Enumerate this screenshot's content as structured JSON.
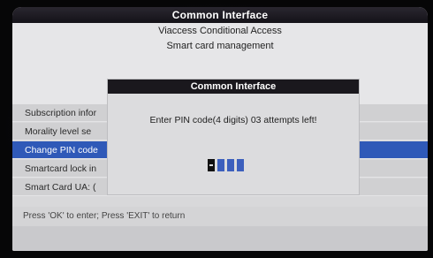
{
  "window": {
    "title": "Common Interface"
  },
  "header": {
    "app_name": "Viaccess Conditional Access",
    "section": "Smart card management"
  },
  "menu": {
    "items": [
      {
        "label": "Subscription infor"
      },
      {
        "label": "Morality level se"
      },
      {
        "label": "Change PIN code"
      },
      {
        "label": "Smartcard lock in"
      },
      {
        "label": "Smart Card UA: ("
      }
    ],
    "selected_index": 2
  },
  "dialog": {
    "title": "Common Interface",
    "message": "Enter PIN code(4 digits) 03 attempts left!",
    "pin_length": 4,
    "digits_entered": 1
  },
  "footer": {
    "hint": "Press 'OK' to enter; Press 'EXIT' to return"
  },
  "colors": {
    "selection": "#2f59b8",
    "title_bar": "#1a181d",
    "pin_empty": "#3c5fbd",
    "pin_filled": "#111111"
  }
}
